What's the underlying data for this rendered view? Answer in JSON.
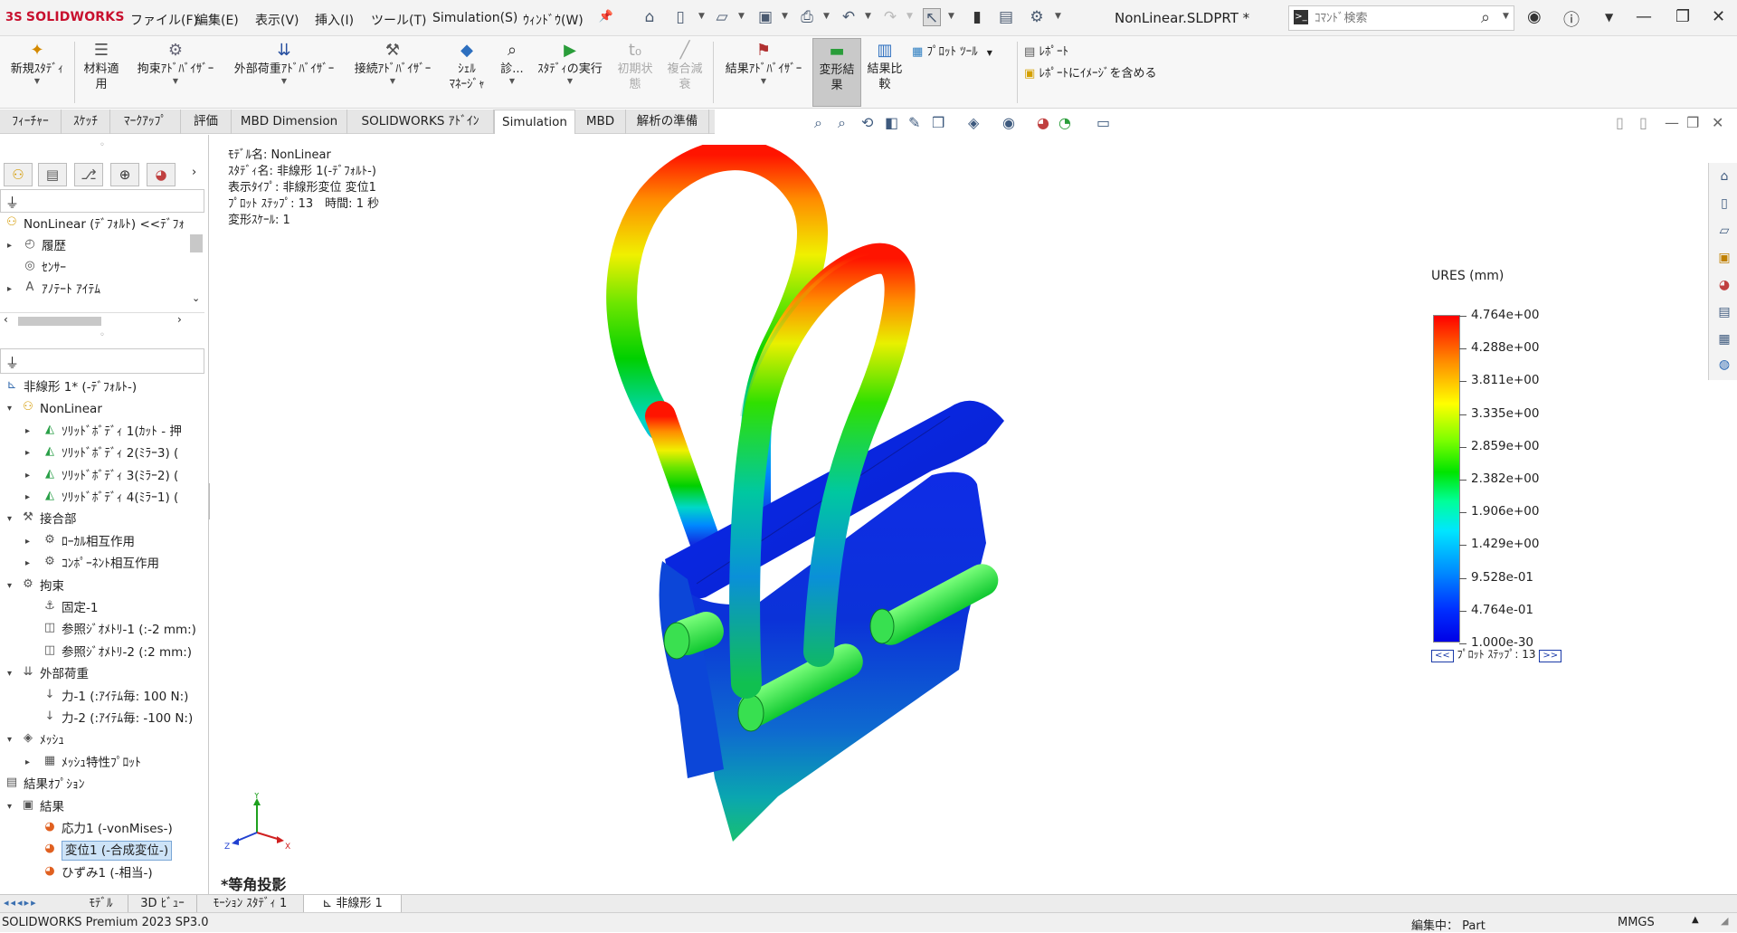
{
  "app": {
    "logo": "SOLIDWORKS",
    "doc_title": "NonLinear.SLDPRT *"
  },
  "menu": [
    "ファイル(F)",
    "編集(E)",
    "表示(V)",
    "挿入(I)",
    "ツール(T)",
    "Simulation(S)",
    "ｳｨﾝﾄﾞｳ(W)"
  ],
  "search": {
    "placeholder": "ｺﾏﾝﾄﾞ検索"
  },
  "ribbon": {
    "new_study": "新規ｽﾀﾃﾞｨ",
    "material": [
      "材料適",
      "用"
    ],
    "fixture_advisor": "拘束ｱﾄﾞﾊﾞｲｻﾞｰ",
    "load_advisor": "外部荷重ｱﾄﾞﾊﾞｲｻﾞｰ",
    "connection_advisor": "接続ｱﾄﾞﾊﾞｲｻﾞｰ",
    "shell_manager": [
      "ｼｪﾙ",
      "ﾏﾈｰｼﾞｬ"
    ],
    "diagnose": "診...",
    "run_study": "ｽﾀﾃﾞｨの実行",
    "initial_state": [
      "初期状",
      "態"
    ],
    "composite": [
      "複合減",
      "衰"
    ],
    "results_advisor": "結果ｱﾄﾞﾊﾞｲｻﾞｰ",
    "deformed_result": [
      "変形結",
      "果"
    ],
    "compare_results": [
      "結果比",
      "較"
    ],
    "plot_tools": "ﾌﾟﾛｯﾄ ﾂｰﾙ",
    "report": "ﾚﾎﾟｰﾄ",
    "include_image": "ﾚﾎﾟｰﾄにｲﾒｰｼﾞを含める"
  },
  "tabs": [
    {
      "label": "ﾌｨｰﾁｬｰ",
      "active": false
    },
    {
      "label": "ｽｹｯﾁ",
      "active": false
    },
    {
      "label": "ﾏｰｸｱｯﾌﾟ",
      "active": false
    },
    {
      "label": "評価",
      "active": false
    },
    {
      "label": "MBD Dimension",
      "active": false
    },
    {
      "label": "SOLIDWORKS ｱﾄﾞｲﾝ",
      "active": false
    },
    {
      "label": "Simulation",
      "active": true
    },
    {
      "label": "MBD",
      "active": false
    },
    {
      "label": "解析の準備",
      "active": false
    }
  ],
  "feature_tree": [
    {
      "label": "NonLinear (ﾃﾞﾌｫﾙﾄ) <<ﾃﾞﾌｫ",
      "indent": 0,
      "arrow": "",
      "icon": "part-icon"
    },
    {
      "label": "履歴",
      "indent": 1,
      "arrow": "▸",
      "icon": "history-icon"
    },
    {
      "label": "ｾﾝｻｰ",
      "indent": 1,
      "arrow": "",
      "icon": "sensor-icon"
    },
    {
      "label": "ｱﾉﾃｰﾄ ｱｲﾃﾑ",
      "indent": 1,
      "arrow": "▸",
      "icon": "annotation-icon"
    }
  ],
  "study_tree": [
    {
      "label": "非線形 1* (-ﾃﾞﾌｫﾙﾄ-)",
      "indent": 0,
      "arrow": "",
      "icon": "study-icon",
      "selected": false
    },
    {
      "label": "NonLinear",
      "indent": 0,
      "arrow": "▾",
      "icon": "part-icon",
      "selected": false
    },
    {
      "label": "ｿﾘｯﾄﾞﾎﾞﾃﾞｨ 1(ｶｯﾄ - 押",
      "indent": 2,
      "arrow": "▸",
      "icon": "solid-body-icon",
      "selected": false
    },
    {
      "label": "ｿﾘｯﾄﾞﾎﾞﾃﾞｨ 2(ﾐﾗｰ3) (",
      "indent": 2,
      "arrow": "▸",
      "icon": "solid-body-icon",
      "selected": false
    },
    {
      "label": "ｿﾘｯﾄﾞﾎﾞﾃﾞｨ 3(ﾐﾗｰ2) (",
      "indent": 2,
      "arrow": "▸",
      "icon": "solid-body-icon",
      "selected": false
    },
    {
      "label": "ｿﾘｯﾄﾞﾎﾞﾃﾞｨ 4(ﾐﾗｰ1) (",
      "indent": 2,
      "arrow": "▸",
      "icon": "solid-body-icon",
      "selected": false
    },
    {
      "label": "接合部",
      "indent": 0,
      "arrow": "▾",
      "icon": "connections-icon",
      "selected": false
    },
    {
      "label": "ﾛｰｶﾙ相互作用",
      "indent": 2,
      "arrow": "▸",
      "icon": "interaction-icon",
      "selected": false
    },
    {
      "label": "ｺﾝﾎﾟｰﾈﾝﾄ相互作用",
      "indent": 2,
      "arrow": "▸",
      "icon": "interaction-icon",
      "selected": false
    },
    {
      "label": "拘束",
      "indent": 0,
      "arrow": "▾",
      "icon": "fixture-icon",
      "selected": false
    },
    {
      "label": "固定-1",
      "indent": 2,
      "arrow": "",
      "icon": "fixed-icon",
      "selected": false
    },
    {
      "label": "参照ｼﾞｵﾒﾄﾘ-1 (:-2 mm:)",
      "indent": 2,
      "arrow": "",
      "icon": "ref-geometry-icon",
      "selected": false
    },
    {
      "label": "参照ｼﾞｵﾒﾄﾘ-2 (:2 mm:)",
      "indent": 2,
      "arrow": "",
      "icon": "ref-geometry-icon",
      "selected": false
    },
    {
      "label": "外部荷重",
      "indent": 0,
      "arrow": "▾",
      "icon": "load-icon",
      "selected": false
    },
    {
      "label": "力-1 (:ｱｲﾃﾑ毎: 100 N:)",
      "indent": 2,
      "arrow": "",
      "icon": "force-icon",
      "selected": false
    },
    {
      "label": "力-2 (:ｱｲﾃﾑ毎: -100 N:)",
      "indent": 2,
      "arrow": "",
      "icon": "force-icon",
      "selected": false
    },
    {
      "label": "ﾒｯｼｭ",
      "indent": 0,
      "arrow": "▾",
      "icon": "mesh-icon",
      "selected": false
    },
    {
      "label": "ﾒｯｼｭ特性ﾌﾟﾛｯﾄ",
      "indent": 2,
      "arrow": "▸",
      "icon": "mesh-plot-icon",
      "selected": false
    },
    {
      "label": "結果ｵﾌﾟｼｮﾝ",
      "indent": 0,
      "arrow": "",
      "icon": "result-options-icon",
      "selected": false
    },
    {
      "label": "結果",
      "indent": 0,
      "arrow": "▾",
      "icon": "results-folder-icon",
      "selected": false
    },
    {
      "label": "応力1 (-vonMises-)",
      "indent": 2,
      "arrow": "",
      "icon": "plot-icon",
      "selected": false
    },
    {
      "label": "変位1 (-合成変位-)",
      "indent": 2,
      "arrow": "",
      "icon": "plot-icon",
      "selected": true
    },
    {
      "label": "ひずみ1 (-相当-)",
      "indent": 2,
      "arrow": "",
      "icon": "plot-icon",
      "selected": false
    }
  ],
  "plot_info": {
    "model": "ﾓﾃﾞﾙ名: NonLinear",
    "study": "ｽﾀﾃﾞｨ名: 非線形 1(-ﾃﾞﾌｫﾙﾄ-)",
    "type": "表示ﾀｲﾌﾟ: 非線形変位 変位1",
    "step": "ﾌﾟﾛｯﾄ ｽﾃｯﾌﾟ: 13　時間: 1 秒",
    "scale": "変形ｽｹｰﾙ: 1"
  },
  "legend": {
    "title": "URES (mm)",
    "labels": [
      "4.764e+00",
      "4.288e+00",
      "3.811e+00",
      "3.335e+00",
      "2.859e+00",
      "2.382e+00",
      "1.906e+00",
      "1.429e+00",
      "9.528e-01",
      "4.764e-01",
      "1.000e-30"
    ],
    "plot_step": "ﾌﾟﾛｯﾄ ｽﾃｯﾌﾟ: 13",
    "prev": "<<",
    "next": ">>"
  },
  "view_label": "*等角投影",
  "bottom_tabs": [
    "ﾓﾃﾞﾙ",
    "3D ﾋﾞｭｰ",
    "ﾓｰｼｮﾝ ｽﾀﾃﾞｨ 1",
    "非線形 1"
  ],
  "status": {
    "product": "SOLIDWORKS Premium 2023 SP3.0",
    "editing": "編集中： Part",
    "units": "MMGS"
  },
  "colors": {
    "accent": "#c8102e",
    "selected_bg": "#cde3f7",
    "max": "#ff0000",
    "min": "#0000e6"
  }
}
